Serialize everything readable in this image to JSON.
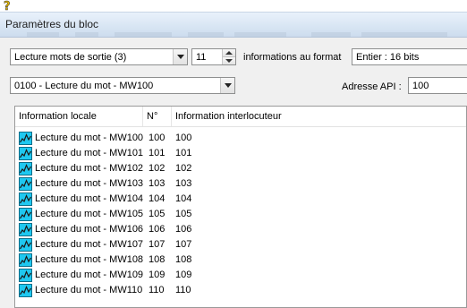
{
  "dialog": {
    "title": "Paramètres du bloc"
  },
  "controls": {
    "type_select": "Lecture mots de sortie (3)",
    "count_value": "11",
    "format_label": "informations au format",
    "format_select": "Entier : 16 bits",
    "word_select": "0100 - Lecture du mot - MW100",
    "api_label": "Adresse API :",
    "api_value": "100"
  },
  "table": {
    "headers": [
      "Information locale",
      "N°",
      "Information interlocuteur"
    ],
    "rows": [
      {
        "local": "Lecture du mot - MW100",
        "n": "100",
        "remote": "100"
      },
      {
        "local": "Lecture du mot - MW101",
        "n": "101",
        "remote": "101"
      },
      {
        "local": "Lecture du mot - MW102",
        "n": "102",
        "remote": "102"
      },
      {
        "local": "Lecture du mot - MW103",
        "n": "103",
        "remote": "103"
      },
      {
        "local": "Lecture du mot - MW104",
        "n": "104",
        "remote": "104"
      },
      {
        "local": "Lecture du mot - MW105",
        "n": "105",
        "remote": "105"
      },
      {
        "local": "Lecture du mot - MW106",
        "n": "106",
        "remote": "106"
      },
      {
        "local": "Lecture du mot - MW107",
        "n": "107",
        "remote": "107"
      },
      {
        "local": "Lecture du mot - MW108",
        "n": "108",
        "remote": "108"
      },
      {
        "local": "Lecture du mot - MW109",
        "n": "109",
        "remote": "109"
      },
      {
        "local": "Lecture du mot - MW110",
        "n": "110",
        "remote": "110"
      }
    ]
  },
  "icons": {
    "row_icon": "waveform-icon",
    "help": "help-icon"
  },
  "colors": {
    "row_icon_bg": "#1fc8f0",
    "titlebar": "#d9e6f4"
  }
}
